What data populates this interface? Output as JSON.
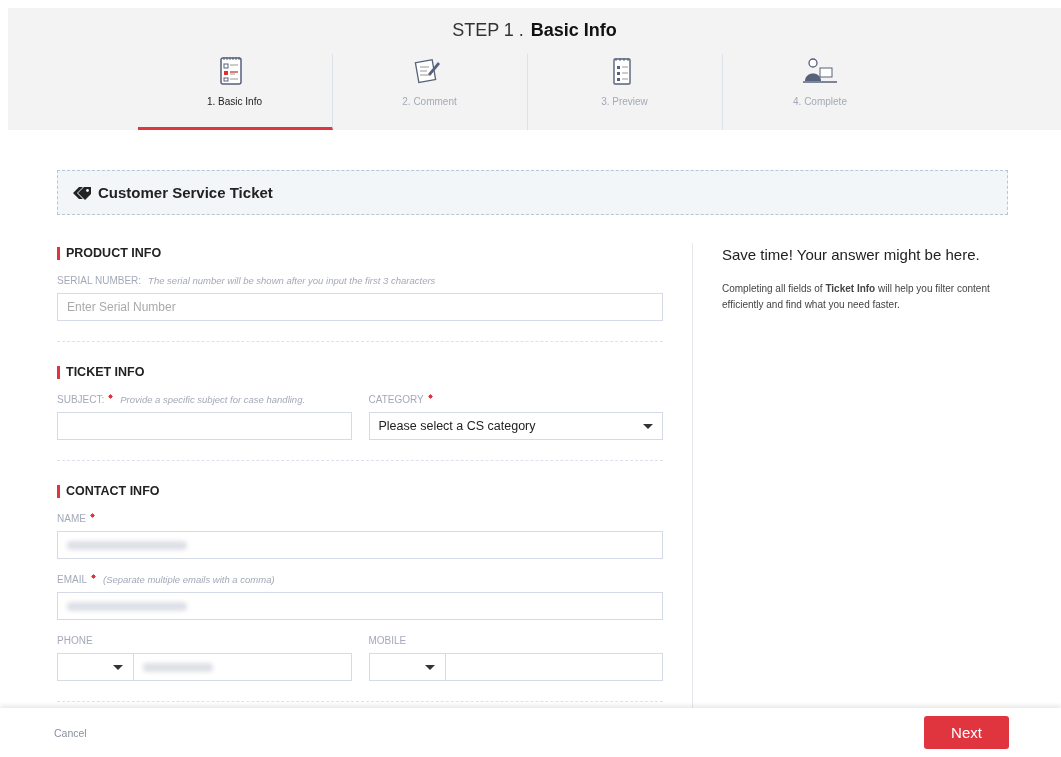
{
  "header": {
    "step_label": "STEP 1 .",
    "step_title": "Basic Info"
  },
  "steps": [
    {
      "label": "1. Basic Info",
      "selected": true,
      "kind": "form"
    },
    {
      "label": "2. Comment",
      "selected": false,
      "kind": "note"
    },
    {
      "label": "3. Preview",
      "selected": false,
      "kind": "list"
    },
    {
      "label": "4. Complete",
      "selected": false,
      "kind": "person"
    }
  ],
  "banner": {
    "title": "Customer Service Ticket"
  },
  "sections": [
    {
      "title": "PRODUCT INFO",
      "rows": [
        [
          {
            "kind": "text",
            "label": "SERIAL NUMBER:",
            "required": false,
            "hint": "The serial number will be shown after you input the first 3 characters",
            "placeholder": "Enter Serial Number"
          }
        ]
      ]
    },
    {
      "title": "TICKET INFO",
      "rows": [
        [
          {
            "kind": "text",
            "label": "SUBJECT:",
            "required": true,
            "hint": "Provide a specific subject for case handling."
          },
          {
            "kind": "select",
            "label": "CATEGORY",
            "required": true,
            "value": "Please select a CS category"
          }
        ]
      ]
    },
    {
      "title": "CONTACT INFO",
      "rows": [
        [
          {
            "kind": "text",
            "label": "NAME",
            "required": true,
            "redacted": true
          }
        ],
        [
          {
            "kind": "text",
            "label": "EMAIL",
            "required": true,
            "hint": "(Separate multiple emails with a comma)",
            "redacted": true
          }
        ],
        [
          {
            "kind": "phone",
            "label": "PHONE",
            "required": false,
            "redacted": true
          },
          {
            "kind": "phone",
            "label": "MOBILE",
            "required": false,
            "redacted": false
          }
        ]
      ]
    }
  ],
  "aside": {
    "title": "Save time! Your answer might be here.",
    "body": "Completing all fields of **Ticket Info** will help you filter content efficiently and find what you need faster."
  },
  "footer": {
    "cancel": "Cancel",
    "next": "Next"
  }
}
